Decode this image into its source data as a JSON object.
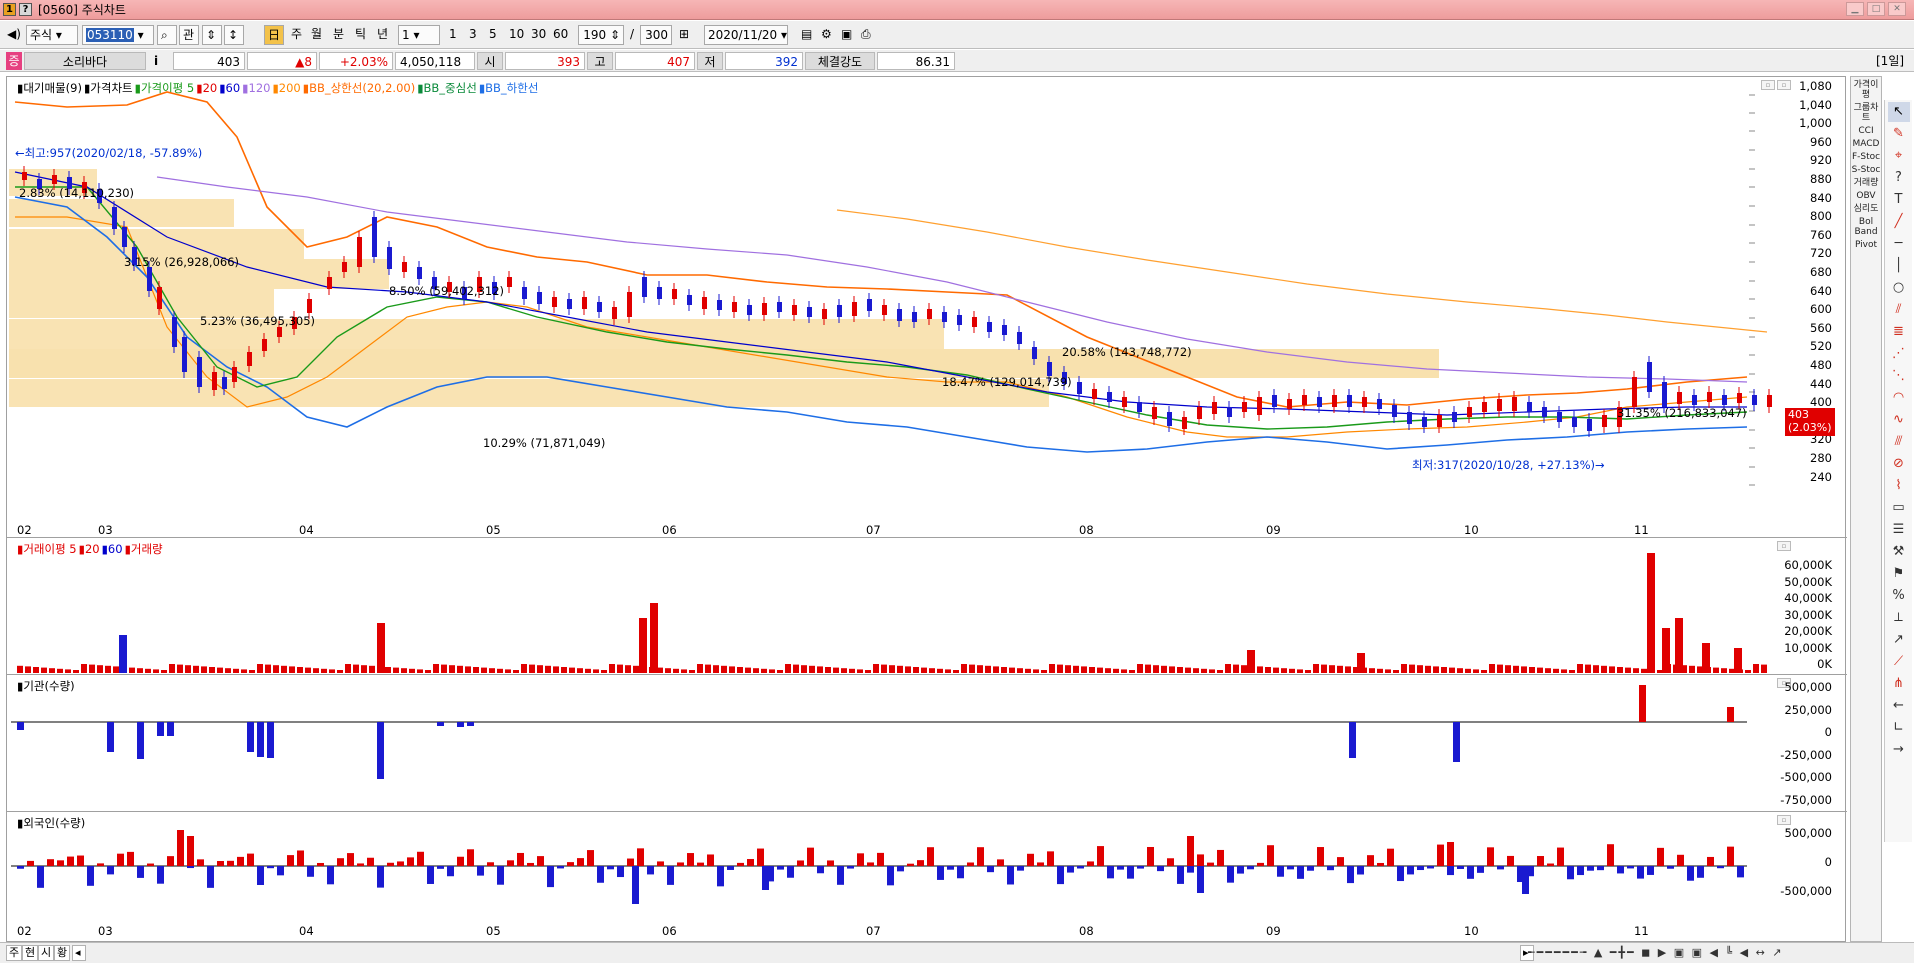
{
  "window": {
    "title": "[0560] 주식차트",
    "icons": [
      "1",
      "?"
    ]
  },
  "toolbar": {
    "market": "주식",
    "code": "053110",
    "btn_search": "⌕",
    "btn_related": "관",
    "periods": [
      "주",
      "월",
      "분",
      "틱",
      "년"
    ],
    "unit_value": "1",
    "minutes": [
      "1",
      "3",
      "5",
      "10",
      "30",
      "60"
    ],
    "view_count": "190",
    "slash": "/",
    "total_count": "300",
    "date": "2020/11/20"
  },
  "quote": {
    "name": "소리바다",
    "price": "403",
    "change": "▲8",
    "change_pct": "+2.03%",
    "volume": "4,050,118",
    "open_label": "시",
    "open": "393",
    "high_label": "고",
    "high": "407",
    "low_label": "저",
    "low": "392",
    "strength_label": "체결강도",
    "strength": "86.31",
    "period_tag": "[1일]"
  },
  "price_pane": {
    "legend": [
      {
        "text": "대기매물(9)",
        "color": "#000000"
      },
      {
        "text": "가격차트",
        "color": "#000000"
      },
      {
        "text": "가격이평 5",
        "color": "#1a9a1a"
      },
      {
        "text": "20",
        "color": "#e00000"
      },
      {
        "text": "60",
        "color": "#0000cc"
      },
      {
        "text": "120",
        "color": "#a070e0"
      },
      {
        "text": "200",
        "color": "#ff8800"
      },
      {
        "text": "BB_상한선(20,2.00)",
        "color": "#ff6a00"
      },
      {
        "text": "BB_중심선",
        "color": "#0a8a3a"
      },
      {
        "text": "BB_하한선",
        "color": "#1e6ee6"
      }
    ],
    "y_ticks": [
      "1,080",
      "1,040",
      "1,000",
      "960",
      "920",
      "880",
      "840",
      "800",
      "760",
      "720",
      "680",
      "640",
      "600",
      "560",
      "520",
      "480",
      "440",
      "400",
      "360",
      "320",
      "280",
      "240"
    ],
    "annotations": {
      "high": "←최고:957(2020/02/18, -57.89%)",
      "low": "최저:317(2020/10/28, +27.13%)→",
      "vp1": "2.83% (14,110,230)",
      "vp2": "3.15% (26,928,066)",
      "vp3": "8.50% (59,402,312)",
      "vp4": "5.23% (36,495,305)",
      "vp5": "20.58% (143,748,772)",
      "vp6": "18.47% (129,014,739)",
      "vp7": "10.29% (71,871,049)",
      "vp8": "31.35% (216,833,047)"
    },
    "price_tag": "403",
    "price_tag_pct": "(2.03%)"
  },
  "x_axis": [
    "02",
    "03",
    "04",
    "05",
    "06",
    "07",
    "08",
    "09",
    "10",
    "11"
  ],
  "volume_pane": {
    "legend": [
      {
        "text": "거래이평 5",
        "color": "#e00000"
      },
      {
        "text": "20",
        "color": "#e00000"
      },
      {
        "text": "60",
        "color": "#0000cc"
      },
      {
        "text": "거래량",
        "color": "#e00000"
      }
    ],
    "y_ticks": [
      "60,000K",
      "50,000K",
      "40,000K",
      "30,000K",
      "20,000K",
      "10,000K",
      "0K"
    ]
  },
  "inst_pane": {
    "legend": "기관(수량)",
    "y_ticks": [
      "500,000",
      "250,000",
      "0",
      "-250,000",
      "-500,000",
      "-750,000"
    ]
  },
  "foreign_pane": {
    "legend": "외국인(수량)",
    "y_ticks": [
      "500,000",
      "0",
      "-500,000"
    ]
  },
  "right_panel": [
    "가격이평",
    "그룹차트",
    "CCI",
    "MACD",
    "F-Stoc",
    "S-Stoc",
    "거래량",
    "OBV",
    "심리도",
    "Bol Band",
    "Pivot"
  ],
  "bottom_tabs": [
    "주",
    "현",
    "시",
    "황"
  ],
  "colors": {
    "up": "#e00000",
    "down": "#1a1ad0",
    "vp": "#f7dca0"
  }
}
